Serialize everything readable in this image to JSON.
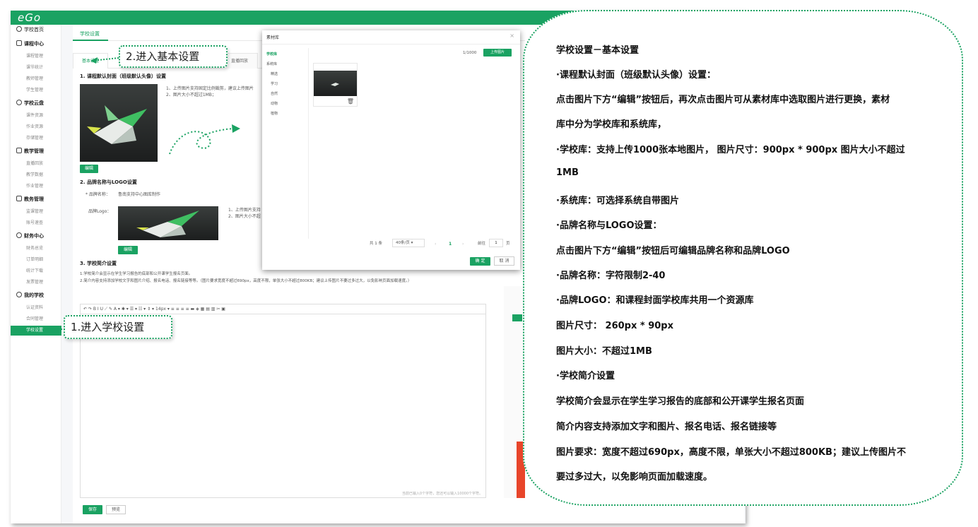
{
  "app": {
    "logo": "eGo",
    "top_tab": "学校设置",
    "sidebar": {
      "top": "学校首页",
      "groups": [
        {
          "title": "课程中心",
          "items": [
            "课程管理",
            "课节统计",
            "教师管理",
            "学生管理"
          ]
        },
        {
          "title": "学校云盘",
          "items": [
            "课件资源",
            "作业资源",
            "存储管理"
          ]
        },
        {
          "title": "教学管理",
          "items": [
            "直播回放",
            "教学数据",
            "作业管理"
          ]
        },
        {
          "title": "教务管理",
          "items": [
            "监课管理",
            "账号速查"
          ]
        },
        {
          "title": "财务中心",
          "items": [
            "财务总览",
            "订单明细",
            "统计下载",
            "发票管理"
          ]
        },
        {
          "title": "我的学校",
          "items": [
            "认证资料",
            "合同管理",
            "学校设置"
          ]
        }
      ]
    },
    "sub_tabs": [
      "基本设置",
      "直播回放"
    ],
    "section1": {
      "title": "1. 课程默认封面（班级默认头像）设置",
      "tips": [
        "1、上传图片支持固定比例裁剪，建议上传图片",
        "2、图片大小不超过1MB；"
      ],
      "edit": "编辑"
    },
    "section2": {
      "title": "2. 品牌名称与LOGO设置",
      "brand_name_label": "* 品牌名称：",
      "brand_name_value": "鲁南支持中心图库制作",
      "logo_label": "品牌Logo：",
      "tips": [
        "1、上传图片支持",
        "2、图片大小不超"
      ],
      "edit": "编辑"
    },
    "section3": {
      "title": "3. 学校简介设置",
      "desc1": "1.学校简介会显示在学生学习报告的底部和公开课学生报名页面。",
      "desc2": "2.简介内容支持添加学校文字和图片介绍、报名电话、报名链接等等。（图片要求宽度不超过690px，高度不限，单张大小不超过800KB；建议上传图片不要过多过大，以免影响页面加载速度。）",
      "toolbar": "↶ ↷  B  I  U  ⟋  ✎  A ▾  ✱ ▾  ☰ ▾  ☷ ▾  ⇕ ▾  14px  ▾  ≡  ≡  ≡  ≡  ▬  ◈  ▦  ▤  ▥  ✂  ▣",
      "counter": "当前已输入0个字符，您还可以输入10000个字符。",
      "save": "保存",
      "preview": "预览"
    }
  },
  "dialog": {
    "title": "素材库",
    "close": "×",
    "nav": [
      "学校库",
      "系统库",
      "精选",
      "学习",
      "自然",
      "动物",
      "植物"
    ],
    "count": "1/1000",
    "upload": "上传图片",
    "pagination": {
      "total": "共 1 条",
      "per_page": "40条/页",
      "page": "1",
      "goto_label": "前往",
      "goto_value": "1",
      "page_unit": "页"
    },
    "confirm": "确 定",
    "cancel": "取 消"
  },
  "callouts": {
    "basic": "2.进入基本设置",
    "school": "1.进入学校设置"
  },
  "info": {
    "lines": [
      "学校设置－基本设置",
      "·课程默认封面（班级默认头像）设置：",
      "点击图片下方“编辑”按钮后，再次点击图片可从素材库中选取图片进行更换，素材",
      "库中分为学校库和系统库，",
      "·学校库：支持上传1000张本地图片， 图片尺寸：900px * 900px 图片大小不超过",
      "1MB",
      "·系统库：可选择系统自带图片",
      "·品牌名称与LOGO设置：",
      "点击图片下方“编辑”按钮后可编辑品牌名称和品牌LOGO",
      "·品牌名称：字符限制2-40",
      "·品牌LOGO：和课程封面学校库共用一个资源库",
      "图片尺寸： 260px * 90px",
      "图片大小：不超过1MB",
      "·学校简介设置",
      "学校简介会显示在学生学习报告的底部和公开课学生报名页面",
      "简介内容支持添加文字和图片、报名电话、报名链接等",
      "图片要求：宽度不超过690px，高度不限，单张大小不超过800KB；建议上传图片不",
      "要过多过大，以免影响页面加载速度。"
    ]
  },
  "colors": {
    "brand": "#1aa262"
  },
  "icons": [
    "home-icon",
    "calendar-icon",
    "cloud-icon",
    "teaching-icon",
    "admin-icon",
    "finance-icon",
    "school-icon",
    "delete-icon",
    "bird-image"
  ]
}
